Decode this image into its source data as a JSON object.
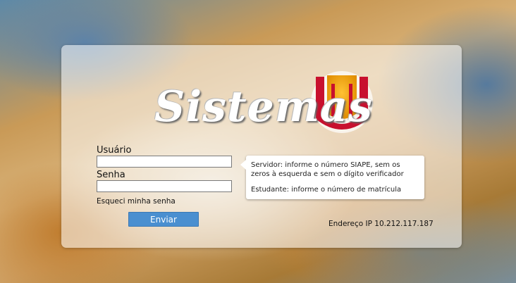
{
  "logo": {
    "text": "Sistemas"
  },
  "form": {
    "user_label": "Usuário",
    "password_label": "Senha",
    "user_value": "",
    "password_value": "",
    "forgot_link": "Esqueci minha senha",
    "submit_label": "Enviar"
  },
  "tooltip": {
    "line1": "Servidor: informe o número SIAPE, sem os",
    "line2": "zeros à esquerda e sem o dígito verificador",
    "line3": "Estudante: informe o número de matrícula"
  },
  "footer": {
    "ip_text": "Endereço IP 10.212.117.187"
  },
  "colors": {
    "button": "#4a8fd0",
    "logo_red": "#c8102e",
    "logo_orange": "#f2a400"
  }
}
